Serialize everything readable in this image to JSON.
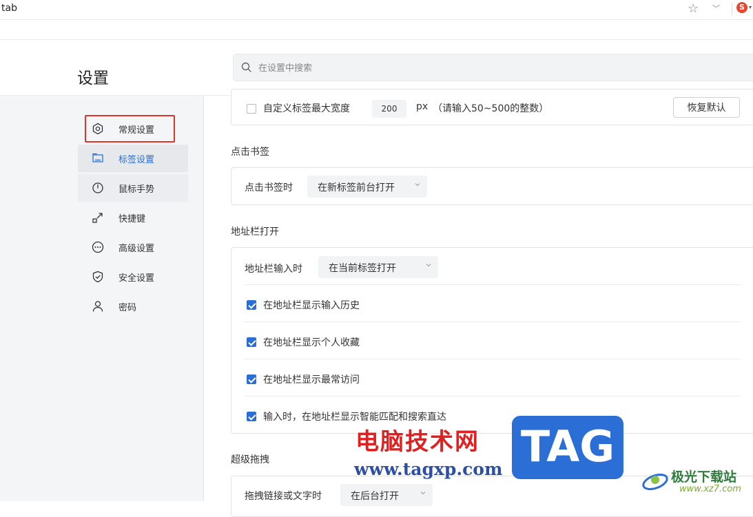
{
  "browser": {
    "tab_title": "tab",
    "logo_letter": "S"
  },
  "header": {
    "title": "设置",
    "search_placeholder": "在设置中搜索"
  },
  "sidebar": {
    "items": [
      {
        "label": "常规设置",
        "icon": "gear-icon",
        "state": "highlighted-box"
      },
      {
        "label": "标签设置",
        "icon": "tab-icon",
        "state": "active"
      },
      {
        "label": "鼠标手势",
        "icon": "mouse-icon",
        "state": "hover"
      },
      {
        "label": "快捷键",
        "icon": "shortcut-icon",
        "state": "normal"
      },
      {
        "label": "高级设置",
        "icon": "more-dots-icon",
        "state": "normal"
      },
      {
        "label": "安全设置",
        "icon": "shield-icon",
        "state": "normal"
      },
      {
        "label": "密码",
        "icon": "user-icon",
        "state": "normal"
      }
    ]
  },
  "tab_width": {
    "label": "自定义标签最大宽度",
    "checked": false,
    "value": "200",
    "unit": "px",
    "hint": "（请输入50~500的整数）",
    "reset_label": "恢复默认"
  },
  "bookmark_click": {
    "section_title": "点击书签",
    "label": "点击书签时",
    "selected": "在新标签前台打开"
  },
  "address_bar": {
    "section_title": "地址栏打开",
    "label": "地址栏输入时",
    "selected": "在当前标签打开",
    "options": [
      {
        "label": "在地址栏显示输入历史",
        "checked": true
      },
      {
        "label": "在地址栏显示个人收藏",
        "checked": true
      },
      {
        "label": "在地址栏显示最常访问",
        "checked": true
      },
      {
        "label": "输入时，在地址栏显示智能匹配和搜索直达",
        "checked": true
      }
    ]
  },
  "super_drag": {
    "section_title": "超级拖拽",
    "label": "拖拽链接或文字时",
    "selected": "在后台打开"
  },
  "watermark": {
    "cn_text": "电脑技术网",
    "url_text": "www.tagxp.com",
    "tag_text": "TAG",
    "site_name": "极光下载站",
    "site_url": "www.xz7.com"
  },
  "colors": {
    "accent": "#2b6fd6",
    "highlight_box": "#e0332c",
    "sidebar_bg": "#f4f5f7"
  }
}
